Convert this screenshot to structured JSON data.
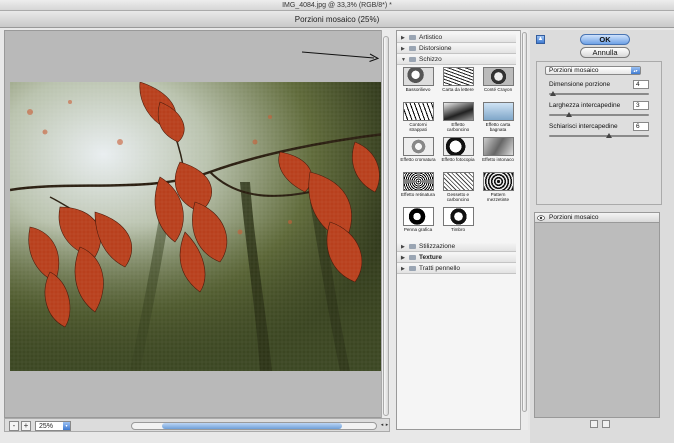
{
  "document": {
    "title": "IMG_4084.jpg @ 33,3% (RGB/8*) *"
  },
  "dialog": {
    "title": "Porzioni mosaico (25%)"
  },
  "preview": {
    "zoom": "25%",
    "zoom_out_label": "-",
    "zoom_in_label": "+"
  },
  "filter_gallery": {
    "categories_top": [
      {
        "label": "Artistico",
        "expanded": false
      },
      {
        "label": "Distorsione",
        "expanded": false
      },
      {
        "label": "Schizzo",
        "expanded": true
      }
    ],
    "thumbnails": [
      "Bassorilievo",
      "Carta da lettere",
      "Conté Crayon",
      "Contorni strappati",
      "Effetto carboncino",
      "Effetto carta bagnata",
      "Effetto cromatura",
      "Effetto fotocopia",
      "Effetto intonaco",
      "Effetto retinatura",
      "Gessetto e carboncino",
      "Pattern mezzetinte",
      "Penna grafica",
      "Timbro"
    ],
    "categories_bottom": [
      {
        "label": "Stilizzazione",
        "expanded": false
      },
      {
        "label": "Texture",
        "expanded": false
      },
      {
        "label": "Tratti pennello",
        "expanded": false
      }
    ]
  },
  "buttons": {
    "ok": "OK",
    "cancel": "Annulla"
  },
  "settings": {
    "selected_filter": "Porzioni mosaico",
    "params": [
      {
        "label": "Dimensione porzione",
        "value": "4",
        "level": 0.04
      },
      {
        "label": "Larghezza intercapedine",
        "value": "3",
        "level": 0.2
      },
      {
        "label": "Schiarisci intercapedine",
        "value": "6",
        "level": 0.6
      }
    ]
  },
  "layers": {
    "items": [
      "Porzioni mosaico"
    ]
  },
  "colors": {
    "ok_button": "#6ea1e6",
    "leaf": "#b8401d",
    "accent": "#3f7ad0"
  }
}
